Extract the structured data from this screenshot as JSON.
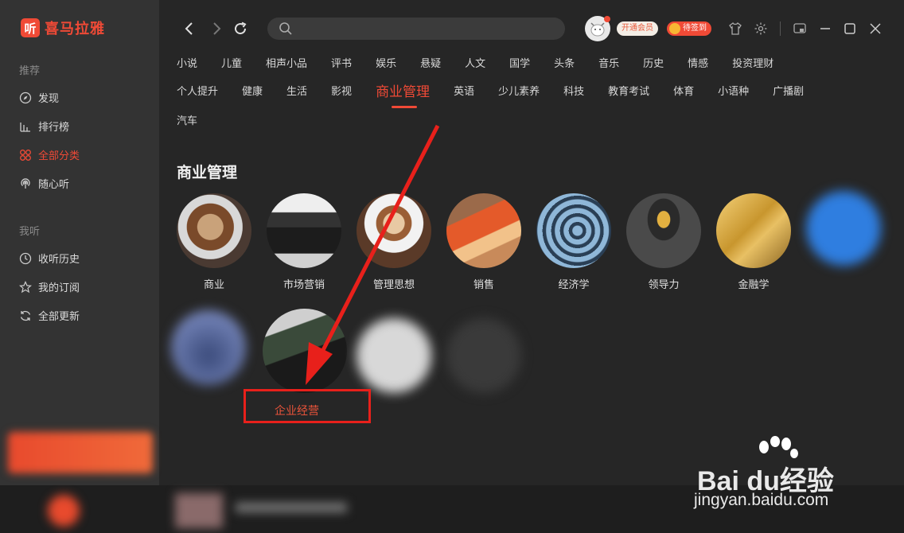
{
  "app": {
    "logo_glyph": "听",
    "logo_text": "喜马拉雅"
  },
  "sidebar": {
    "section1": "推荐",
    "items1": [
      {
        "label": "发现",
        "icon": "compass-icon"
      },
      {
        "label": "排行榜",
        "icon": "chart-icon"
      },
      {
        "label": "全部分类",
        "icon": "grid-icon",
        "active": true
      },
      {
        "label": "随心听",
        "icon": "radio-icon"
      }
    ],
    "section2": "我听",
    "items2": [
      {
        "label": "收听历史",
        "icon": "clock-icon"
      },
      {
        "label": "我的订阅",
        "icon": "star-icon"
      },
      {
        "label": "全部更新",
        "icon": "refresh-icon"
      }
    ]
  },
  "topbar": {
    "search_placeholder": "",
    "vip_label": "开通会员",
    "sign_label": "待签到"
  },
  "categories": {
    "row1": [
      "小说",
      "儿童",
      "相声小品",
      "评书",
      "娱乐",
      "悬疑",
      "人文",
      "国学",
      "头条",
      "音乐",
      "历史",
      "情感",
      "投资理财"
    ],
    "row2": [
      "个人提升",
      "健康",
      "生活",
      "影视",
      "商业管理",
      "英语",
      "少儿素养",
      "科技",
      "教育考试",
      "体育",
      "小语种",
      "广播剧"
    ],
    "row3": [
      "汽车"
    ],
    "active": "商业管理"
  },
  "section": {
    "title": "商业管理",
    "subcategories": [
      "商业",
      "市场营销",
      "管理思想",
      "销售",
      "经济学",
      "领导力",
      "金融学"
    ],
    "highlighted": "企业经营"
  },
  "watermark": {
    "brand": "Bai du经验",
    "url": "jingyan.baidu.com"
  },
  "colors": {
    "accent": "#f04a36",
    "annotation": "#e8201b"
  }
}
